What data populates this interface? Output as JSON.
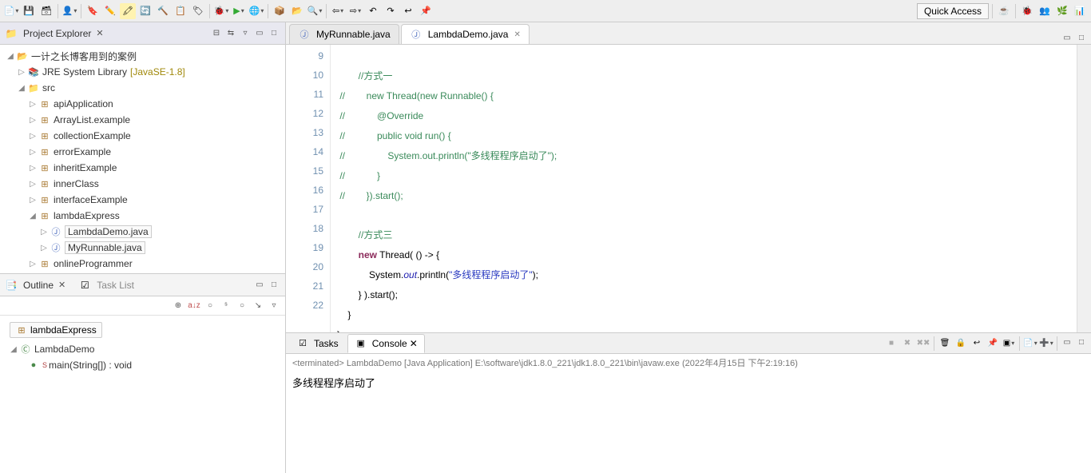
{
  "toolbar": {
    "quick_access": "Quick Access"
  },
  "project_explorer": {
    "title": "Project Explorer",
    "project_name": "一计之长博客用到的案例",
    "jre_label": "JRE System Library",
    "jre_deco": "[JavaSE-1.8]",
    "src_label": "src",
    "packages": [
      "apiApplication",
      "ArrayList.example",
      "collectionExample",
      "errorExample",
      "inheritExample",
      "innerClass",
      "interfaceExample",
      "lambdaExpress",
      "onlineProgrammer"
    ],
    "lambda_files": [
      "LambdaDemo.java",
      "MyRunnable.java"
    ]
  },
  "outline": {
    "title": "Outline",
    "tasklist_title": "Task List",
    "package": "lambdaExpress",
    "class": "LambdaDemo",
    "method": "main(String[]) : void",
    "s_badge": "S"
  },
  "editor": {
    "tab1": "MyRunnable.java",
    "tab2": "LambdaDemo.java",
    "line_numbers": [
      "9",
      "10",
      "11",
      "12",
      "13",
      "14",
      "15",
      "16",
      "17",
      "18",
      "19",
      "20",
      "21",
      "22"
    ],
    "lines": {
      "l9": "        //方式一",
      "l10": " //        new Thread(new Runnable() {",
      "l11": " //            @Override",
      "l12": " //            public void run() {",
      "l13": " //                System.out.println(\"多线程程序启动了\");",
      "l14": " //            }",
      "l15": " //        }).start();",
      "l17": "        //方式三",
      "l18a": "        ",
      "l18b": "new",
      "l18c": " Thread( () -> {",
      "l19a": "            System.",
      "l19b": "out",
      "l19c": ".println(",
      "l19d": "\"多线程程序启动了\"",
      "l19e": ");",
      "l20": "        } ).start();",
      "l21": "    }",
      "l22": "}"
    }
  },
  "console": {
    "tasks_tab": "Tasks",
    "console_tab": "Console",
    "status": "<terminated> LambdaDemo [Java Application] E:\\software\\jdk1.8.0_221\\jdk1.8.0_221\\bin\\javaw.exe (2022年4月15日 下午2:19:16)",
    "output": "多线程程序启动了"
  }
}
